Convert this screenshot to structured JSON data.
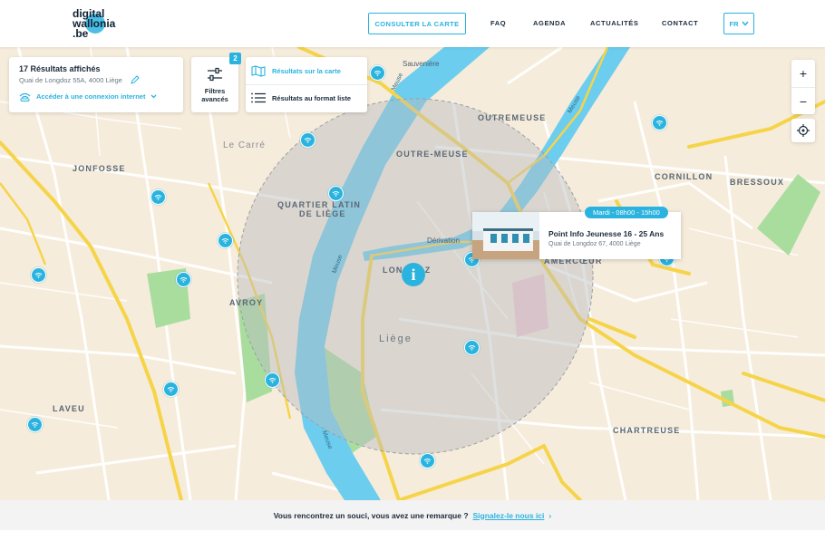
{
  "header": {
    "logo_lines": [
      "digital",
      "wallonia",
      ".be"
    ],
    "map_button": "CONSULTER LA CARTE",
    "nav": [
      "FAQ",
      "AGENDA",
      "ACTUALITÉS",
      "CONTACT"
    ],
    "language": "FR"
  },
  "results_panel": {
    "count": "17 Résultats affichés",
    "address": "Quai de Longdoz 55A, 4000 Liège",
    "connection_link": "Accéder à une connexion internet"
  },
  "filters": {
    "badge": "2",
    "label_line1": "Filtres",
    "label_line2": "avancés"
  },
  "views": {
    "map_view": "Résultats sur la carte",
    "list_view": "Résultats au format liste"
  },
  "zoom": {
    "in": "+",
    "out": "−"
  },
  "map": {
    "areas": {
      "outremeuse": "OUTREMEUSE",
      "outre_meuse": "OUTRE-MEUSE",
      "jonfosse": "JONFOSSE",
      "quartier_latin_1": "QUARTIER LATIN",
      "quartier_latin_2": "DE LIÈGE",
      "avroy": "AVROY",
      "laveu": "LAVEU",
      "cornillon": "CORNILLON",
      "bressoux": "BRESSOUX",
      "chartreuse": "CHARTREUSE",
      "amercoeur": "AMERCŒUR",
      "longdoz": "LONGDOZ",
      "le_carre": "Le Carré",
      "liege": "Liège"
    },
    "roads": {
      "sauveniere": "Sauvenière",
      "derivation": "Dérivation"
    },
    "water": {
      "meuse_1": "Meuse",
      "meuse_2": "Meuse",
      "meuse_3": "Meuse",
      "meuse_4": "Meuse"
    }
  },
  "popup": {
    "hours": "Mardi - 08h00 - 15h00",
    "name": "Point Info Jeunesse 16 - 25 Ans",
    "address": "Quai de Longdoz 67, 4000 Liège"
  },
  "footer": {
    "question": "Vous rencontrez un souci, vous avez une remarque ?",
    "link": "Signalez-le nous ici",
    "chevron": "›"
  },
  "colors": {
    "accent": "#2ab3df",
    "water": "#6ccdef",
    "park": "#a9dd9e",
    "road_major": "#f6d449",
    "map_bg": "#f6ecdc"
  },
  "icons": [
    "wifi-pin-icon",
    "info-pin-icon",
    "pencil-icon",
    "wifi-icon",
    "chevron-down-icon",
    "sliders-icon",
    "map-icon",
    "list-icon",
    "locate-icon"
  ]
}
